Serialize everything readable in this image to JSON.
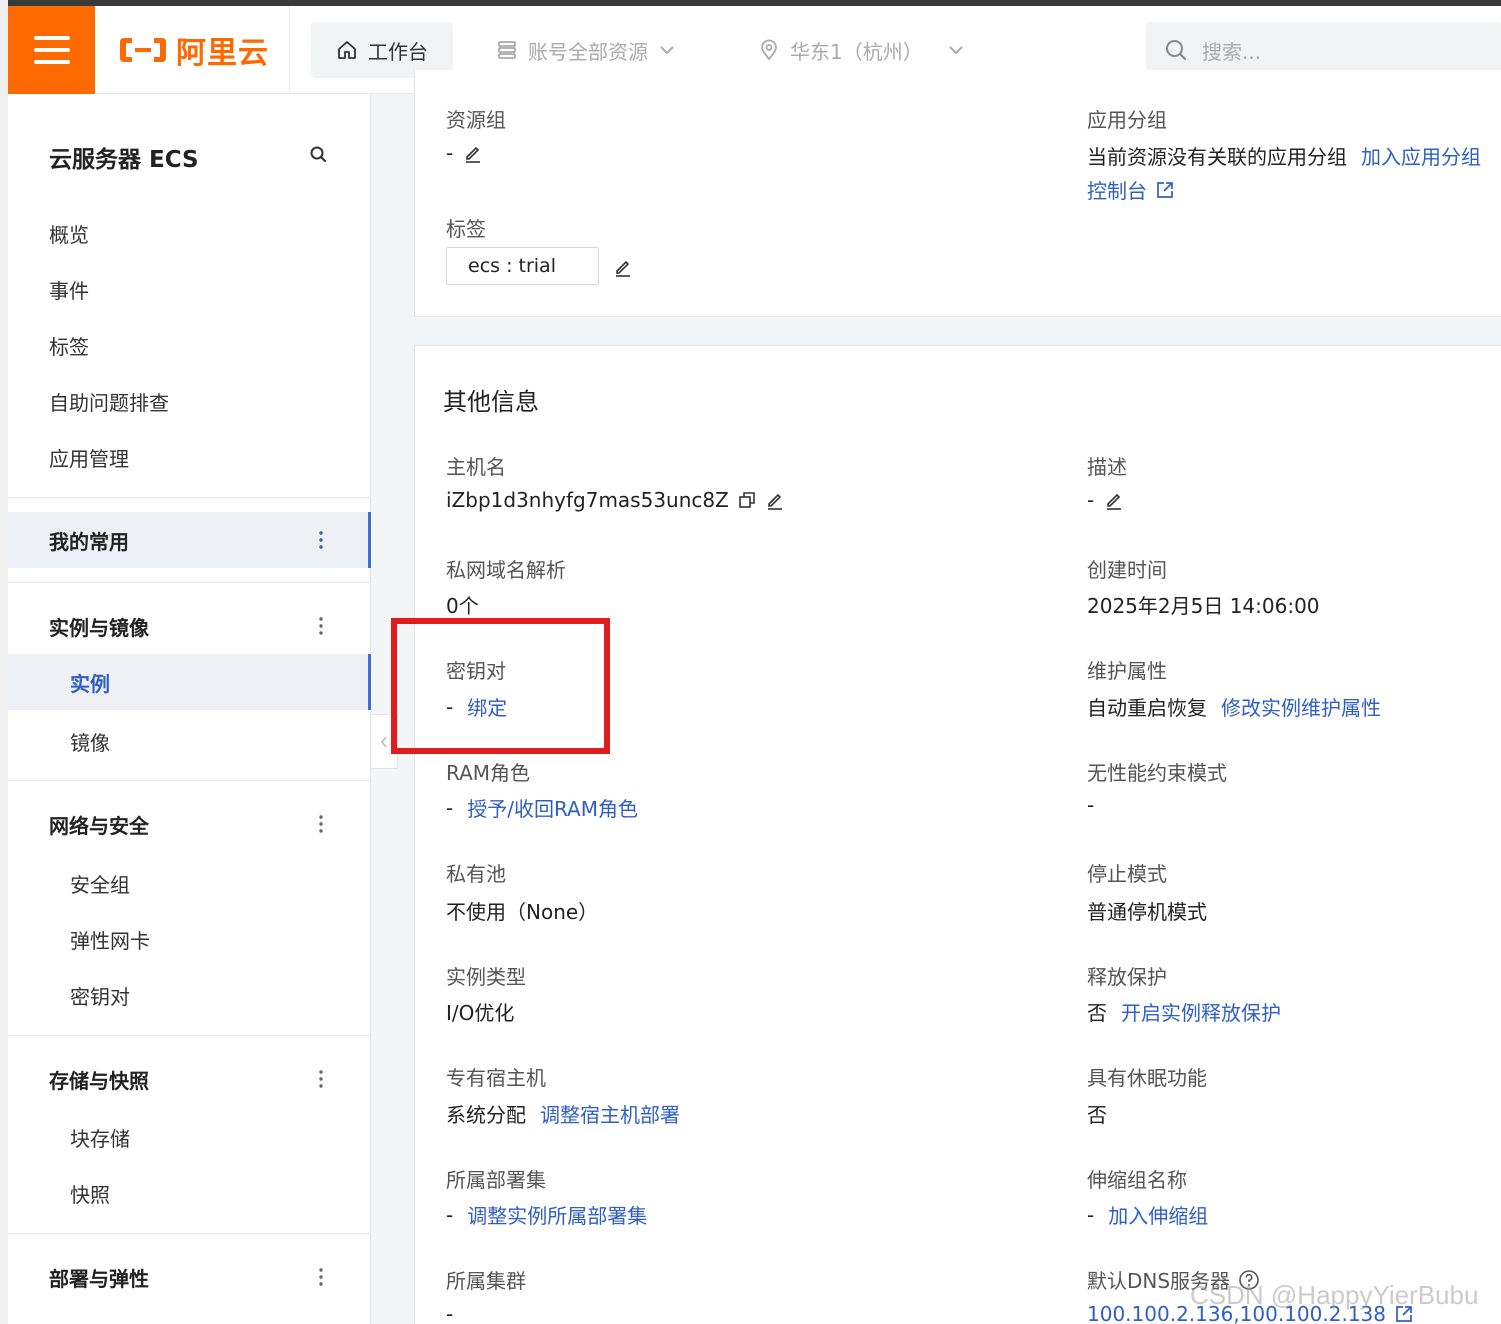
{
  "header": {
    "logo_text": "阿里云",
    "workbench_label": "工作台",
    "resources_label": "账号全部资源",
    "region_label": "华东1（杭州）",
    "search_placeholder": "搜索..."
  },
  "sidebar": {
    "title": "云服务器 ECS",
    "links": [
      "概览",
      "事件",
      "标签",
      "自助问题排查",
      "应用管理"
    ],
    "groups": {
      "favorites": "我的常用",
      "instances_images": "实例与镜像",
      "network_security": "网络与安全",
      "storage_snapshots": "存储与快照",
      "deploy_elastic": "部署与弹性"
    },
    "sub": {
      "instance": "实例",
      "image": "镜像",
      "security_group": "安全组",
      "eni": "弹性网卡",
      "keypair": "密钥对",
      "block_storage": "块存储",
      "snapshot": "快照"
    }
  },
  "top_card": {
    "resource_group_label": "资源组",
    "resource_group_value": "-",
    "app_group_label": "应用分组",
    "app_group_value": "当前资源没有关联的应用分组",
    "app_group_link": "加入应用分组",
    "console_link": "控制台",
    "tags_label": "标签",
    "tag_value": "ecs : trial"
  },
  "other_info": {
    "title": "其他信息",
    "hostname_label": "主机名",
    "hostname_value": "iZbp1d3nhyfg7mas53unc8Z",
    "description_label": "描述",
    "description_value": "-",
    "private_dns_label": "私网域名解析",
    "private_dns_value": "0个",
    "created_label": "创建时间",
    "created_value": "2025年2月5日 14:06:00",
    "keypair_label": "密钥对",
    "keypair_dash": "-",
    "keypair_link": "绑定",
    "maintenance_label": "维护属性",
    "maintenance_value": "自动重启恢复",
    "maintenance_link": "修改实例维护属性",
    "ram_label": "RAM角色",
    "ram_dash": "-",
    "ram_link": "授予/收回RAM角色",
    "unlimited_label": "无性能约束模式",
    "unlimited_value": "-",
    "private_pool_label": "私有池",
    "private_pool_value": "不使用（None）",
    "stop_mode_label": "停止模式",
    "stop_mode_value": "普通停机模式",
    "instance_type_label": "实例类型",
    "instance_type_value": "I/O优化",
    "release_protect_label": "释放保护",
    "release_protect_value": "否",
    "release_protect_link": "开启实例释放保护",
    "dedicated_host_label": "专有宿主机",
    "dedicated_host_value": "系统分配",
    "dedicated_host_link": "调整宿主机部署",
    "hibernation_label": "具有休眠功能",
    "hibernation_value": "否",
    "deployment_set_label": "所属部署集",
    "deployment_set_dash": "-",
    "deployment_set_link": "调整实例所属部署集",
    "scaling_group_label": "伸缩组名称",
    "scaling_group_dash": "-",
    "scaling_group_link": "加入伸缩组",
    "cluster_label": "所属集群",
    "cluster_value": "-",
    "dns_label": "默认DNS服务器",
    "dns_value": "100.100.2.136,100.100.2.138"
  },
  "watermark": "CSDN @HappyYierBubu",
  "colors": {
    "brand": "#ff6a00",
    "link": "#2f5fc4",
    "highlight": "#e01c1c"
  }
}
